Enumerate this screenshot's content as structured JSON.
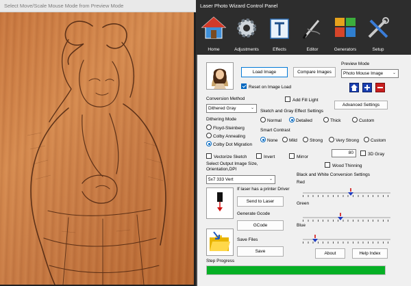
{
  "preview": {
    "title": "Select Move/Scale Mouse Mode from Preview Mode",
    "image": "laser-engraved-portrait-girl"
  },
  "panel": {
    "title": "Laser Photo Wizard Control Panel",
    "toolbar": [
      {
        "label": "Home",
        "icon": "home-icon"
      },
      {
        "label": "Adjustments",
        "icon": "gear-icon"
      },
      {
        "label": "Effects",
        "icon": "effects-icon"
      },
      {
        "label": "Editor",
        "icon": "pen-icon"
      },
      {
        "label": "Generators",
        "icon": "generators-icon"
      },
      {
        "label": "Setup",
        "icon": "tools-icon"
      }
    ],
    "load_image": "Load Image",
    "compare_images": "Compare Images",
    "preview_mode_label": "Preview Mode",
    "preview_mode_value": "Photo Mouse Image",
    "reset_on_load": "Reset on Image Load",
    "reset_on_load_checked": true,
    "conversion_method_label": "Conversion Method",
    "conversion_method_value": "Dithered Gray",
    "add_fill_light": "Add Fill Light",
    "add_fill_light_checked": false,
    "sketch_gray_label": "Sketch and Gray Effect Settings",
    "sketch_options": [
      "Normal",
      "Detailed",
      "Thick",
      "Custom"
    ],
    "sketch_selected": "Detailed",
    "advanced_settings": "Advanced Settings",
    "dithering_label": "Dithering Mode",
    "dithering_options": [
      "Floyd-Steinberg",
      "Colby Annealing",
      "Colby Dot Migration"
    ],
    "dithering_selected": "Colby Dot Migration",
    "smart_contrast_label": "Smart Contrast",
    "contrast_options": [
      "None",
      "Mild",
      "Strong",
      "Very Strong",
      "Custom"
    ],
    "contrast_selected": "None",
    "vectorize_sketch": "Vectorize Sketch",
    "invert": "Invert",
    "mirror": "Mirror",
    "gray_value": "80",
    "gray_3d": "3D Gray",
    "wood_thinning": "Wood Thinning",
    "output_size_label": "Select Output Image Size, Orientation,DPI",
    "output_size_value": "5x7 333 Vert",
    "bw_conversion_label": "Black and White Conversion Settings",
    "red_label": "Red",
    "green_label": "Green",
    "blue_label": "Blue",
    "red_value": 0.55,
    "green_value": 0.43,
    "blue_value": 0.14,
    "printer_driver_label": "If laser has a printer Driver",
    "send_to_laser": "Send to Laser",
    "generate_gcode_label": "Generate Gcode",
    "gcode": "GCode",
    "save_files_label": "Save Files",
    "save": "Save",
    "about": "About",
    "help_index": "Help Index",
    "step_progress_label": "Step Progress",
    "step_progress_value": 1.0,
    "colors": {
      "accent": "#0067c0",
      "progress": "#06b025",
      "titlebar": "#2d2d2d",
      "thumb": "#1f3cc0",
      "thumb_tick": "#d01010"
    }
  }
}
